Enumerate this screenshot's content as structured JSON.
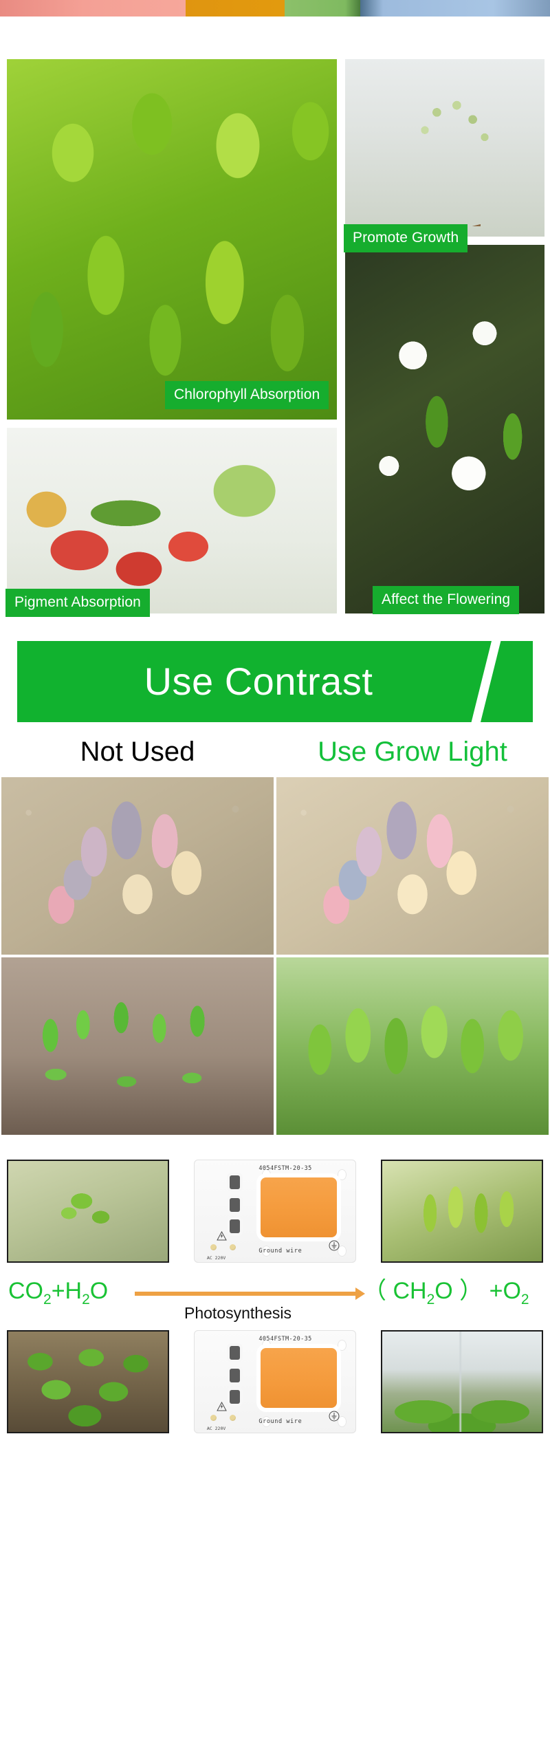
{
  "top_strip": {
    "colors": [
      "#f4a095",
      "#e29a0e",
      "#7fba60",
      "#a8c5e4"
    ]
  },
  "benefits": {
    "accent_color": "#16ad2e",
    "items": [
      {
        "name": "chlorophyll",
        "caption": "Chlorophyll Absorption",
        "art": "green-leaf-crop"
      },
      {
        "name": "promote-growth",
        "caption": "Promote Growth",
        "art": "plant-buds"
      },
      {
        "name": "pigment",
        "caption": "Pigment Absorption",
        "art": "vegetables"
      },
      {
        "name": "flowering",
        "caption": "Affect the Flowering",
        "art": "white-blossom"
      }
    ]
  },
  "banner": {
    "title": "Use Contrast",
    "background_color": "#11b22f",
    "text_color": "#ffffff"
  },
  "contrast": {
    "headings": [
      {
        "label": "Not Used",
        "color": "#000000"
      },
      {
        "label": "Use Grow Light",
        "color": "#13c03a"
      }
    ],
    "rows": [
      {
        "left_art": "succulent-dull",
        "right_art": "succulent-vivid"
      },
      {
        "left_art": "seedlings-sparse",
        "right_art": "leaves-lush"
      }
    ]
  },
  "photosynthesis": {
    "top_row": [
      {
        "name": "sprout-photo",
        "art": "sprout-soft"
      },
      {
        "name": "led-chip-photo",
        "art": "led-chip"
      },
      {
        "name": "leaf-tips-photo",
        "art": "leaf-tips"
      }
    ],
    "bottom_row": [
      {
        "name": "lettuce-field-photo",
        "art": "field"
      },
      {
        "name": "led-chip-photo",
        "art": "led-chip"
      },
      {
        "name": "greenhouse-photo",
        "art": "greenhouse"
      }
    ],
    "equation": {
      "reactants": "CO2+H2O",
      "reactants_parts": [
        {
          "text": "CO",
          "sub": "2"
        },
        {
          "text": "+H",
          "sub": "2"
        },
        {
          "text": "O",
          "sub": ""
        }
      ],
      "products_parts": [
        {
          "text": "（ CH",
          "sub": "2"
        },
        {
          "text": "O ） +O",
          "sub": "2"
        }
      ],
      "arrow_label": "Photosynthesis",
      "arrow_color": "#eea144",
      "text_color": "#19c234"
    }
  },
  "led_chip": {
    "model": "4054FSTM-20-35",
    "ground_label": "Ground wire",
    "voltage_label": "AC 220V",
    "emitter_color": "#f59c3e"
  }
}
